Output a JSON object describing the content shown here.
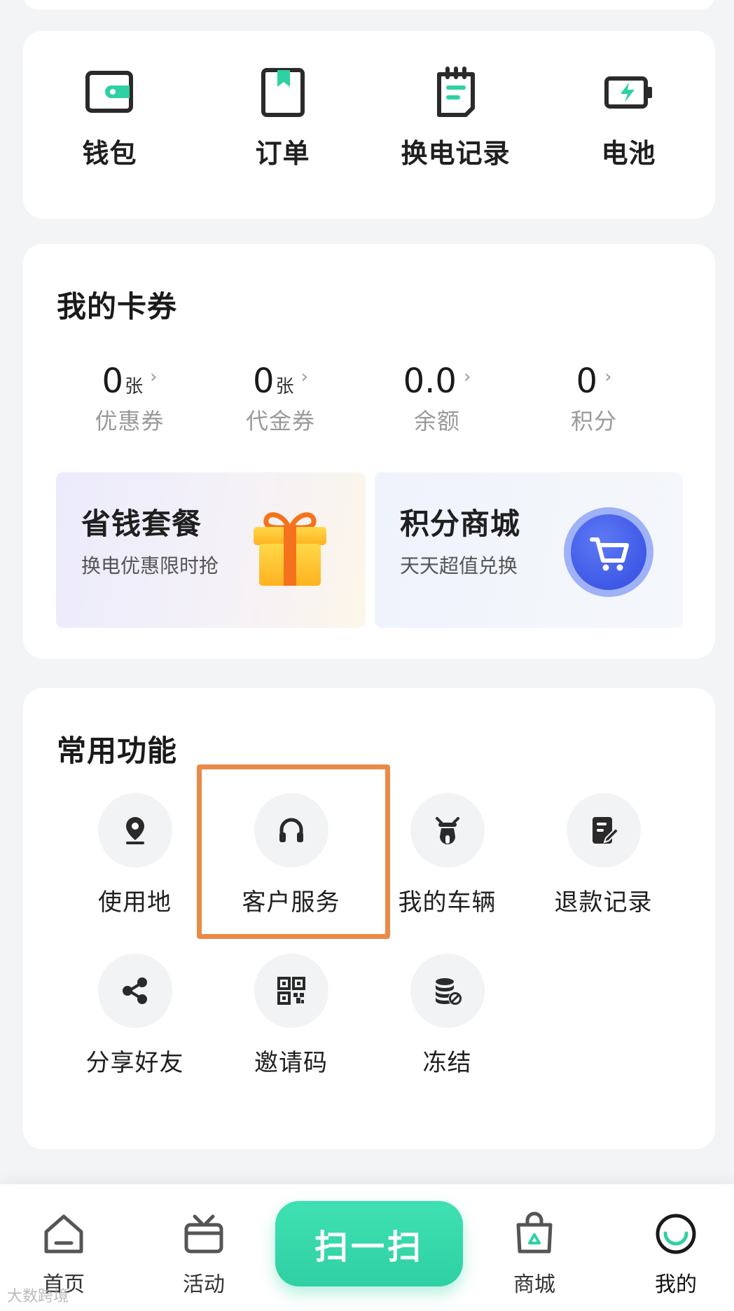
{
  "colors": {
    "accent": "#2fd0a3",
    "highlight_box": "#e98a47",
    "icon_dark": "#2a2a2a",
    "page_bg": "#f2f4f6"
  },
  "quick_entries": [
    {
      "label": "钱包",
      "icon": "wallet-icon"
    },
    {
      "label": "订单",
      "icon": "order-book-icon"
    },
    {
      "label": "换电记录",
      "icon": "clipboard-record-icon"
    },
    {
      "label": "电池",
      "icon": "battery-icon"
    }
  ],
  "coupons": {
    "title": "我的卡券",
    "stats": [
      {
        "value": "0",
        "unit": "张",
        "label": "优惠券"
      },
      {
        "value": "0",
        "unit": "张",
        "label": "代金券"
      },
      {
        "value": "0.0",
        "unit": "",
        "label": "余额"
      },
      {
        "value": "0",
        "unit": "",
        "label": "积分"
      }
    ],
    "chevron": "›",
    "promos": [
      {
        "title": "省钱套餐",
        "subtitle": "换电优惠限时抢",
        "icon": "gift-icon"
      },
      {
        "title": "积分商城",
        "subtitle": "天天超值兑换",
        "icon": "shopping-cart-icon"
      }
    ]
  },
  "functions": {
    "title": "常用功能",
    "items": [
      {
        "label": "使用地",
        "icon": "location-pin-icon"
      },
      {
        "label": "客户服务",
        "icon": "headset-icon"
      },
      {
        "label": "我的车辆",
        "icon": "scooter-icon"
      },
      {
        "label": "退款记录",
        "icon": "edit-document-icon"
      },
      {
        "label": "分享好友",
        "icon": "share-icon"
      },
      {
        "label": "邀请码",
        "icon": "qr-code-icon"
      },
      {
        "label": "冻结",
        "icon": "frozen-coins-icon"
      }
    ]
  },
  "bottom_nav": {
    "items": [
      {
        "label": "首页",
        "icon": "home-icon"
      },
      {
        "label": "活动",
        "icon": "activity-box-icon"
      },
      {
        "label": "商城",
        "icon": "shopping-bag-icon"
      },
      {
        "label": "我的",
        "icon": "profile-smile-icon",
        "active": true
      }
    ],
    "scan_label": "扫一扫"
  },
  "watermark": "大数跨境"
}
